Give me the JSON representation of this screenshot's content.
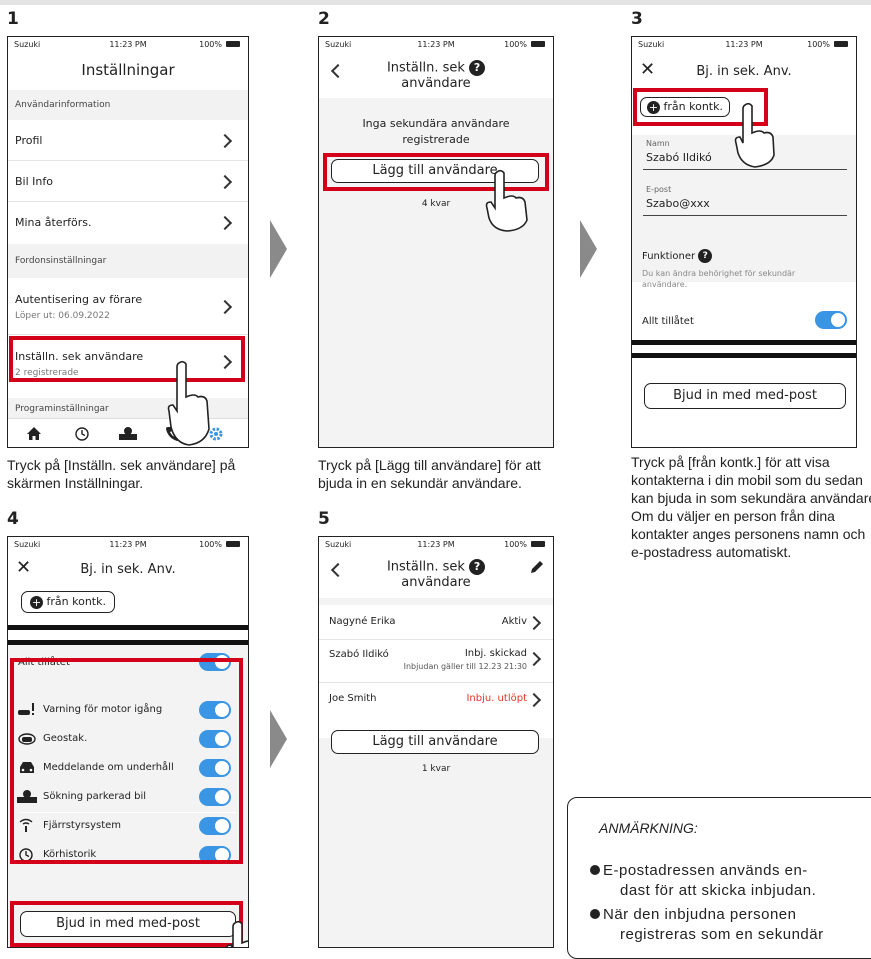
{
  "steps": [
    "1",
    "2",
    "3",
    "4",
    "5"
  ],
  "status": {
    "carrier": "Suzuki",
    "time": "11:23 PM",
    "battery": "100%"
  },
  "screen1": {
    "title": "Inställningar",
    "section1": "Användarinformation",
    "items": [
      {
        "label": "Profil"
      },
      {
        "label": "Bil Info"
      },
      {
        "label": "Mina återförs."
      }
    ],
    "section2": "Fordonsinställningar",
    "auth": {
      "label": "Autentisering av förare",
      "sub": "Löper ut: 06.09.2022"
    },
    "sek": {
      "label": "Inställn. sek användare",
      "sub": "2 registrerade"
    },
    "section3": "Programinställningar",
    "caption": "Tryck på [Inställn. sek användare] på skärmen Inställningar."
  },
  "screen2": {
    "title_line1": "Inställn. sek",
    "title_line2": "användare",
    "empty_line1": "Inga sekundära användare",
    "empty_line2": "registrerade",
    "add_button": "Lägg till användare",
    "remaining": "4 kvar",
    "caption": "Tryck på [Lägg till användare] för att bjuda in en sekundär användare."
  },
  "screen3": {
    "title": "Bj. in sek. Anv.",
    "contacts_button": "från kontk.",
    "name_label": "Namn",
    "name_value": "Szabó Ildikó",
    "email_label": "E-post",
    "email_value": "Szabo@xxx",
    "functions_label": "Funktioner",
    "functions_desc_line1": "Du kan ändra behörighet för sekundär",
    "functions_desc_line2": "användare.",
    "all_allowed": "Allt tillåtet",
    "invite_button": "Bjud in med med-post",
    "caption": "Tryck på [från kontk.] för att visa kontakterna i din mobil som du sedan kan bjuda in som sekundära användare. Om du väljer en person från dina kontakter anges personens namn och e-postadress automatiskt."
  },
  "screen4": {
    "title": "Bj. in sek. Anv.",
    "contacts_button": "från kontk.",
    "all_allowed": "Allt tillåtet",
    "functions": [
      {
        "label": "Varning för motor igång",
        "icon": "engine-warning-icon"
      },
      {
        "label": "Geostak.",
        "icon": "geofence-car-icon"
      },
      {
        "label": "Meddelande om underhåll",
        "icon": "car-maintenance-icon"
      },
      {
        "label": "Sökning parkerad bil",
        "icon": "parked-car-map-icon"
      },
      {
        "label": "Fjärrstyrsystem",
        "icon": "remote-signal-icon"
      },
      {
        "label": "Körhistorik",
        "icon": "history-icon"
      }
    ],
    "invite_button": "Bjud in med med-post"
  },
  "screen5": {
    "title_line1": "Inställn. sek",
    "title_line2": "användare",
    "users": [
      {
        "name": "Nagyné Erika",
        "status": "Aktiv",
        "status_color": "#333333",
        "sub": ""
      },
      {
        "name": "Szabó Ildikó",
        "status": "Inbj. skickad",
        "status_color": "#333333",
        "sub": "Inbjudan gäller till 12.23 21:30"
      },
      {
        "name": "Joe Smith",
        "status": "Inbju. utlöpt",
        "status_color": "#e8352b",
        "sub": ""
      }
    ],
    "add_button": "Lägg till användare",
    "remaining": "1 kvar"
  },
  "note": {
    "title": "ANMÄRKNING:",
    "bullet1_line1": "E-postadressen används en-",
    "bullet1_line2": "dast för att skicka inbjudan.",
    "bullet2_line1": "När den inbjudna personen",
    "bullet2_line2": "registreras som en sekundär"
  },
  "colors": {
    "highlight": "#d4001a",
    "accent": "#3a95e4",
    "expired": "#e8352b"
  }
}
